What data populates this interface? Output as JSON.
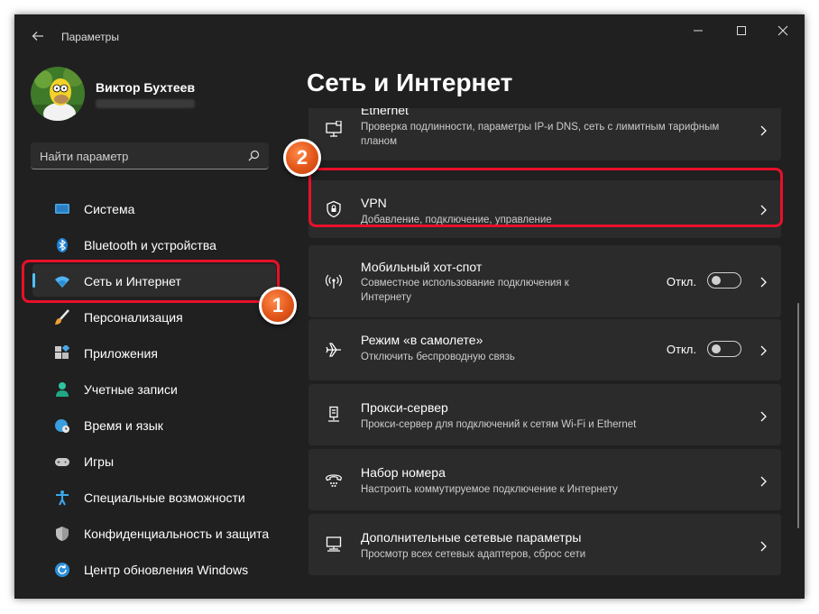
{
  "window": {
    "title": "Параметры"
  },
  "user": {
    "name": "Виктор Бухтеев"
  },
  "search": {
    "placeholder": "Найти параметр"
  },
  "sidebar": {
    "items": [
      {
        "label": "Система",
        "icon": "monitor-icon"
      },
      {
        "label": "Bluetooth и устройства",
        "icon": "bluetooth-icon"
      },
      {
        "label": "Сеть и Интернет",
        "icon": "wifi-icon",
        "active": true
      },
      {
        "label": "Персонализация",
        "icon": "brush-icon"
      },
      {
        "label": "Приложения",
        "icon": "apps-icon"
      },
      {
        "label": "Учетные записи",
        "icon": "person-icon"
      },
      {
        "label": "Время и язык",
        "icon": "globe-clock-icon"
      },
      {
        "label": "Игры",
        "icon": "gamepad-icon"
      },
      {
        "label": "Специальные возможности",
        "icon": "accessibility-icon"
      },
      {
        "label": "Конфиденциальность и защита",
        "icon": "shield-icon"
      },
      {
        "label": "Центр обновления Windows",
        "icon": "update-icon"
      }
    ]
  },
  "main": {
    "title": "Сеть и Интернет",
    "cards": [
      {
        "title": "Ethernet",
        "subtitle": "Проверка подлинности, параметры IP-и DNS, сеть с лимитным тарифным планом",
        "icon": "ethernet-icon"
      },
      {
        "title": "VPN",
        "subtitle": "Добавление, подключение, управление",
        "icon": "vpn-shield-icon"
      },
      {
        "title": "Мобильный хот-спот",
        "subtitle": "Совместное использование подключения к Интернету",
        "icon": "hotspot-icon",
        "toggle_label": "Откл."
      },
      {
        "title": "Режим «в самолете»",
        "subtitle": "Отключить беспроводную связь",
        "icon": "airplane-icon",
        "toggle_label": "Откл."
      },
      {
        "title": "Прокси-сервер",
        "subtitle": "Прокси-сервер для подключений к сетям Wi-Fi и Ethernet",
        "icon": "proxy-icon"
      },
      {
        "title": "Набор номера",
        "subtitle": "Настроить коммутируемое подключение к Интернету",
        "icon": "dialup-icon"
      },
      {
        "title": "Дополнительные сетевые параметры",
        "subtitle": "Просмотр всех сетевых адаптеров, сброс сети",
        "icon": "network-adapter-icon"
      }
    ]
  },
  "annotations": {
    "badge1": "1",
    "badge2": "2"
  },
  "colors": {
    "accent": "#4cc2ff",
    "highlight": "#e8102a",
    "badge": "#e2561a"
  }
}
